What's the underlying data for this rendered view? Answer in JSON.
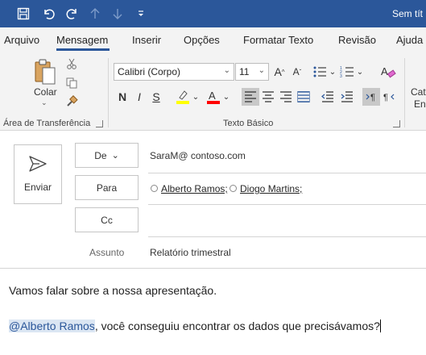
{
  "window": {
    "title": "Sem tít"
  },
  "quick_access": [
    {
      "icon": "save-icon",
      "glyph": "🖫"
    },
    {
      "icon": "undo-icon",
      "glyph": "↶"
    },
    {
      "icon": "redo-icon",
      "glyph": "↻"
    },
    {
      "icon": "up-arrow-icon",
      "glyph": "↑"
    },
    {
      "icon": "down-arrow-icon",
      "glyph": "↓"
    },
    {
      "icon": "customize-icon",
      "glyph": "≂"
    }
  ],
  "menu": {
    "tabs": [
      "Arquivo",
      "Mensagem",
      "Inserir",
      "Opções",
      "Formatar Texto",
      "Revisão",
      "Ajuda"
    ],
    "active": "Mensagem"
  },
  "ribbon": {
    "clipboard": {
      "paste_label": "Colar",
      "group_label": "Área de Transferência"
    },
    "basic_text": {
      "font_name": "Calibri (Corpo)",
      "font_size": "11",
      "grow_font": "A",
      "shrink_font": "A",
      "bold": "N",
      "italic": "I",
      "underline": "S",
      "group_label": "Texto Básico"
    },
    "cut_label": "Cat",
    "cut_label2": "En"
  },
  "compose": {
    "send_label": "Enviar",
    "from_label": "De",
    "from_value": "SaraM@ contoso.com",
    "to_label": "Para",
    "to_recipients": [
      "Alberto Ramos;",
      "Diogo Martins;"
    ],
    "cc_label": "Cc",
    "subject_label": "Assunto",
    "subject_value": "Relatório trimestral",
    "body_line1": "Vamos falar sobre a nossa apresentação.",
    "body_mention": "@Alberto Ramos",
    "body_line2_rest": ", você conseguiu encontrar os dados que precisávamos?"
  },
  "colors": {
    "titlebar": "#2b579a",
    "ribbon_bg": "#f3f3f3",
    "highlight_yellow": "#ffff00",
    "font_red": "#ff0000",
    "mention_bg": "#dbe6f3"
  }
}
